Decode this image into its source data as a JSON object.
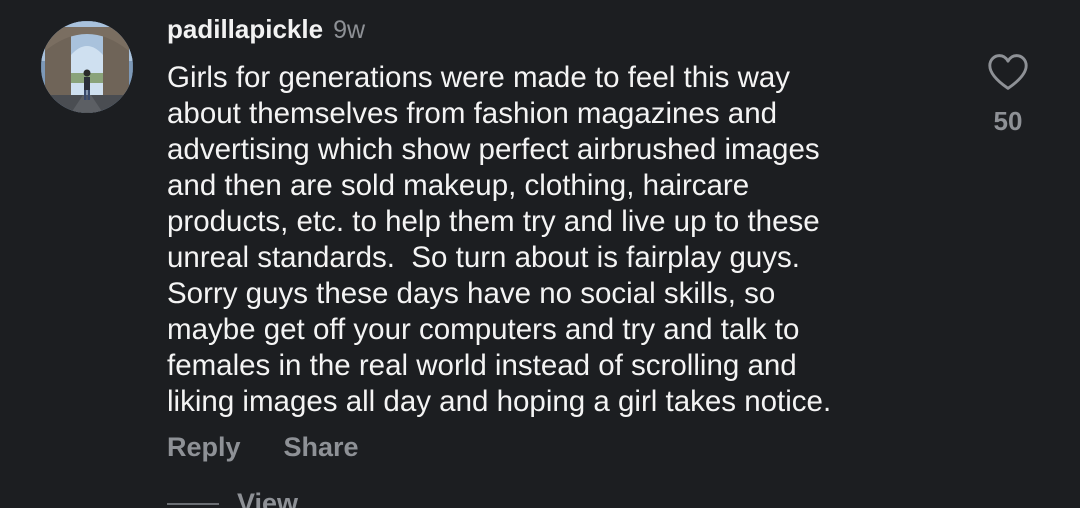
{
  "comment": {
    "username": "padillapickle",
    "age": "9w",
    "lines": [
      "Girls for generations were made to feel this way",
      "about themselves from fashion magazines and",
      "advertising which show perfect airbrushed images",
      "and then are sold makeup, clothing, haircare",
      "products, etc. to help them try and live up to these",
      "unreal standards.  So turn about is fairplay guys.",
      "Sorry guys these days have no social skills, so",
      "maybe get off your computers and try and talk to",
      "females in the real world instead of scrolling and",
      "liking images all day and hoping a girl takes notice."
    ],
    "like_count": "50",
    "reply_label": "Reply",
    "share_label": "Share",
    "view_replies_label": "View"
  },
  "icons": {
    "avatar": "avatar-photo",
    "like": "heart-outline-icon"
  },
  "colors": {
    "background": "#1c1e21",
    "text_primary": "#f4f4f4",
    "text_secondary": "#8e9196"
  }
}
